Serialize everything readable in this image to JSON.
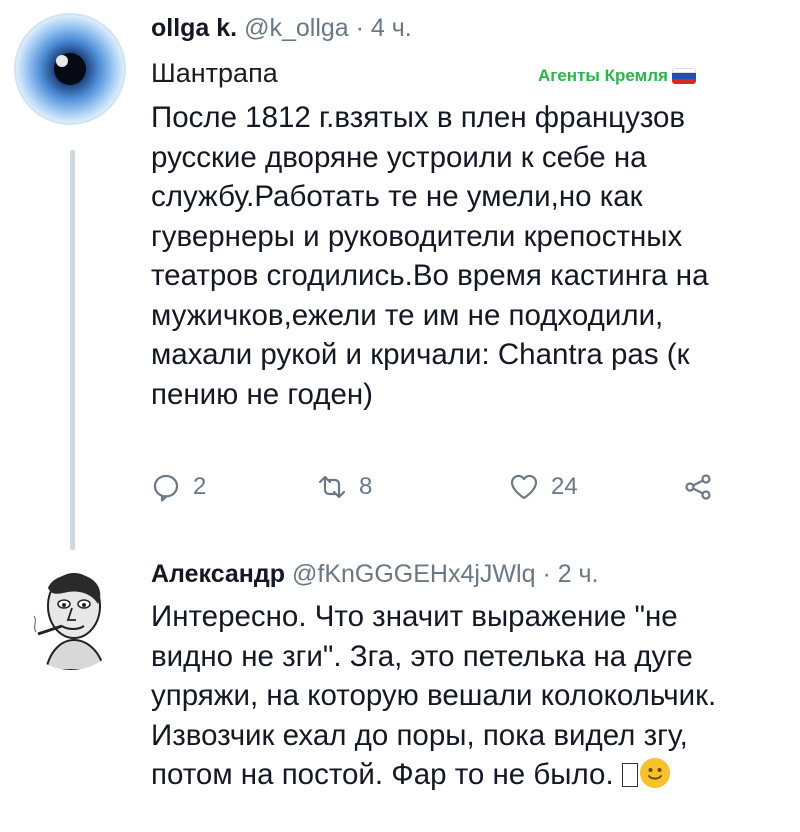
{
  "tweet1": {
    "name": "ollga k.",
    "handle": "@k_ollga",
    "time": "· 4 ч.",
    "subtitle": "Шантрапа",
    "badge": "Агенты Кремля",
    "text": "После 1812 г.взятых в плен французов\nрусские дворяне устроили к себе на\nслужбу.Работать те не умели,но как\nгувернеры и руководители крепостных\nтеатров сгодились.Во время кастинга на\nмужичков,ежели те им не подходили,\nмахали рукой и кричали: Chantra pas (к\nпению не годен)",
    "replies": "2",
    "retweets": "8",
    "likes": "24",
    "icons": {
      "reply": "reply-icon",
      "retweet": "retweet-icon",
      "like": "heart-icon",
      "share": "share-icon"
    }
  },
  "tweet2": {
    "name": "Александр",
    "handle": "@fKnGGGEHx4jJWlq",
    "time": "· 2 ч.",
    "text": "Интересно. Что значит выражение \"не\nвидно не зги\". Зга, это петелька на дуге\nупряжи, на которую вешали колокольчик.\nИзвозчик ехал до поры, пока видел згу,\nпотом на постой. Фар то не было. "
  },
  "colors": {
    "badge": "#2cb34a",
    "muted": "#6b7884",
    "text": "#141823",
    "line": "#cfd9de"
  }
}
